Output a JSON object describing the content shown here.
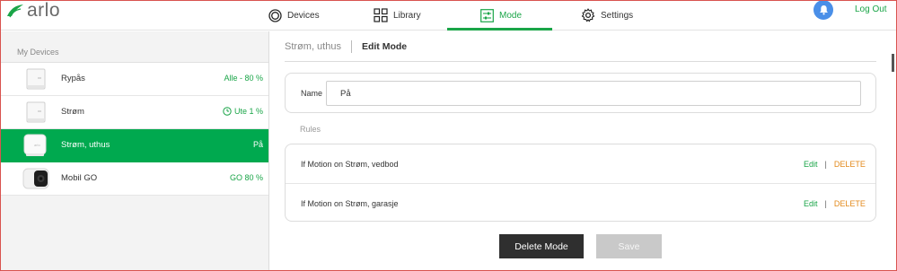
{
  "app": {
    "logo_text": "arlo"
  },
  "nav": {
    "items": [
      {
        "label": "Devices",
        "icon": "devices-icon"
      },
      {
        "label": "Library",
        "icon": "library-grid-icon"
      },
      {
        "label": "Mode",
        "icon": "mode-sliders-icon",
        "active": true
      },
      {
        "label": "Settings",
        "icon": "gear-icon"
      }
    ],
    "logout_label": "Log Out"
  },
  "sidebar": {
    "title": "My Devices",
    "devices": [
      {
        "name": "Rypås",
        "status": "Alle - 80 %",
        "icon": "base-station-icon"
      },
      {
        "name": "Strøm",
        "status": "Ute 1 %",
        "status_icon": "clock-icon",
        "icon": "base-station-icon"
      },
      {
        "name": "Strøm, uthus",
        "status": "På",
        "icon": "base-station-white-icon",
        "active": true
      },
      {
        "name": "Mobil GO",
        "status": "GO 80 %",
        "icon": "camera-icon"
      }
    ]
  },
  "main": {
    "breadcrumb_parent": "Strøm, uthus",
    "breadcrumb_current": "Edit Mode",
    "name_label": "Name",
    "name_value": "På",
    "rules_label": "Rules",
    "rules": [
      {
        "text": "If Motion on Strøm, vedbod",
        "edit": "Edit",
        "sep": "|",
        "delete": "DELETE"
      },
      {
        "text": "If Motion on Strøm, garasje",
        "edit": "Edit",
        "sep": "|",
        "delete": "DELETE"
      }
    ],
    "delete_mode_label": "Delete Mode",
    "save_label": "Save"
  },
  "colors": {
    "accent": "#00a94f",
    "delete": "#e38a1c",
    "bell": "#4a8fe8"
  }
}
